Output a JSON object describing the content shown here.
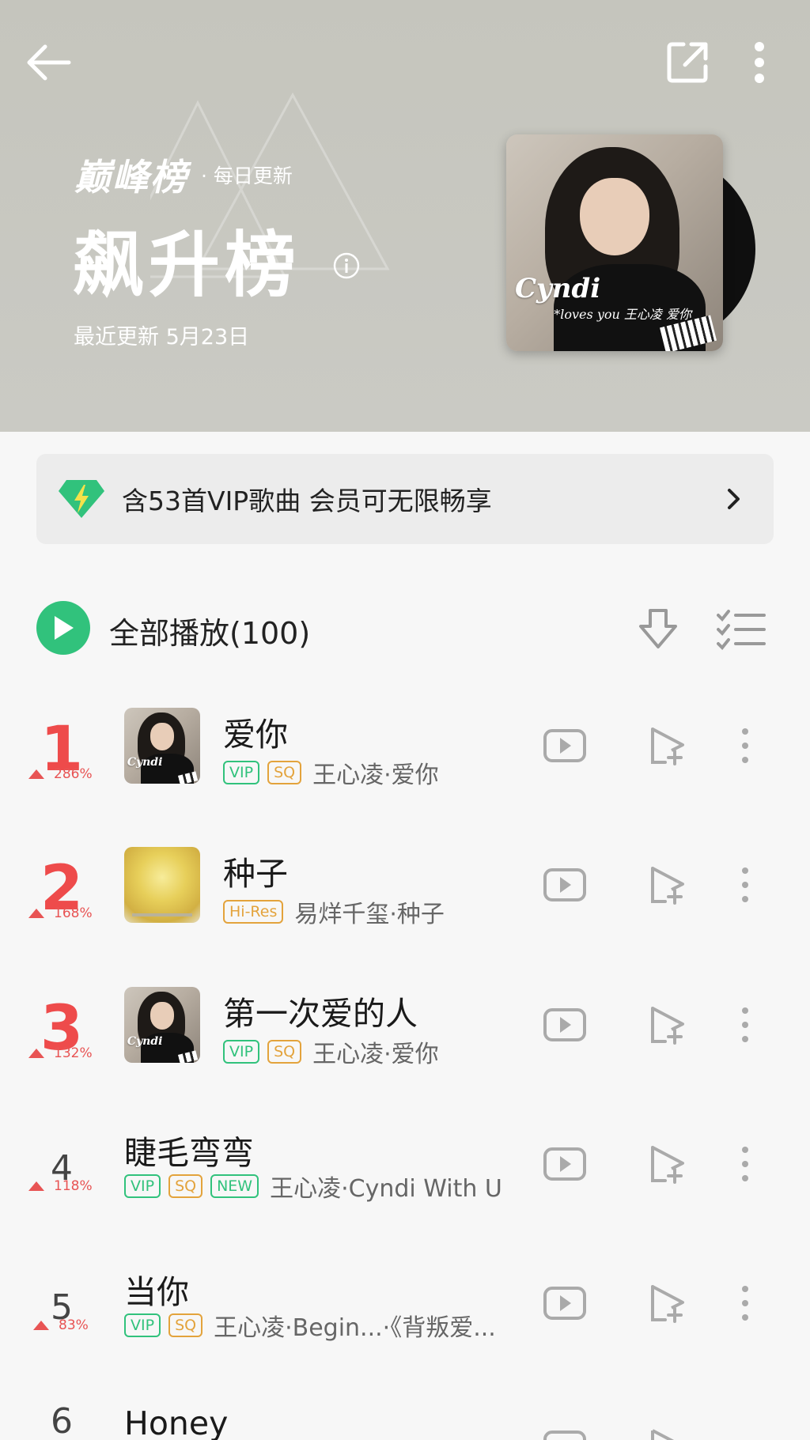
{
  "header": {
    "brand": "巅峰榜",
    "brand_sub": "· 每日更新",
    "title": "飙升榜",
    "update_text": "最近更新 5月23日",
    "cover_logo": "Cyndi",
    "cover_logo_sub": "*loves you 王心凌 爱你"
  },
  "vip_banner": {
    "text": "含53首VIP歌曲 会员可无限畅享"
  },
  "play_all": {
    "label": "全部播放(100)"
  },
  "colors": {
    "accent_green": "#31c27c",
    "rank_red": "#ee4b4b",
    "badge_orange": "#e3a33c"
  },
  "songs": [
    {
      "rank": "1",
      "trend": "286%",
      "title": "爱你",
      "badges": [
        "VIP",
        "SQ"
      ],
      "artist": "王心凌·爱你",
      "cover": "cyndi"
    },
    {
      "rank": "2",
      "trend": "168%",
      "title": "种子",
      "badges": [
        "Hi-Res"
      ],
      "artist": "易烊千玺·种子",
      "cover": "seed"
    },
    {
      "rank": "3",
      "trend": "132%",
      "title": "第一次爱的人",
      "badges": [
        "VIP",
        "SQ"
      ],
      "artist": "王心凌·爱你",
      "cover": "cyndi"
    },
    {
      "rank": "4",
      "trend": "118%",
      "title": "睫毛弯弯",
      "badges": [
        "VIP",
        "SQ",
        "NEW"
      ],
      "artist": "王心凌·Cyndi With U",
      "cover": ""
    },
    {
      "rank": "5",
      "trend": "83%",
      "title": "当你",
      "badges": [
        "VIP",
        "SQ"
      ],
      "artist": "王心凌·Begin...·《背叛爱...",
      "cover": ""
    },
    {
      "rank": "6",
      "trend": "",
      "title": "Honey",
      "badges": [],
      "artist": "",
      "cover": ""
    }
  ]
}
